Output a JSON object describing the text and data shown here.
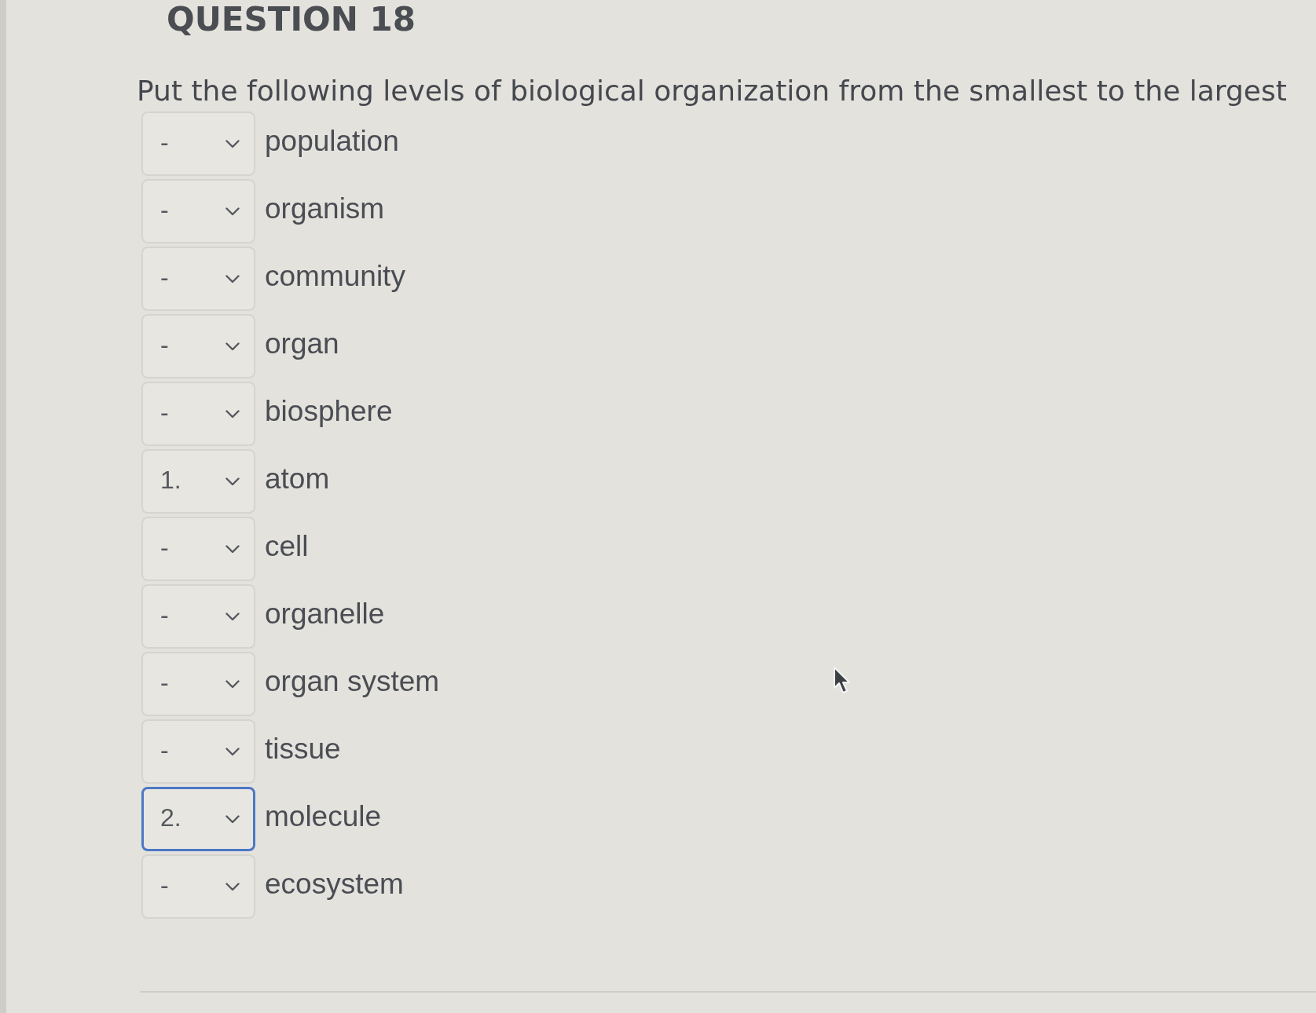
{
  "question": {
    "title": "QUESTION 18",
    "instruction": "Put the following levels of biological organization from the smallest to the largest"
  },
  "items": [
    {
      "value": "-",
      "label": "population",
      "focused": false
    },
    {
      "value": "-",
      "label": "organism",
      "focused": false
    },
    {
      "value": "-",
      "label": "community",
      "focused": false
    },
    {
      "value": "-",
      "label": "organ",
      "focused": false
    },
    {
      "value": "-",
      "label": "biosphere",
      "focused": false
    },
    {
      "value": "1.",
      "label": "atom",
      "focused": false
    },
    {
      "value": "-",
      "label": "cell",
      "focused": false
    },
    {
      "value": "-",
      "label": "organelle",
      "focused": false
    },
    {
      "value": "-",
      "label": "organ system",
      "focused": false
    },
    {
      "value": "-",
      "label": "tissue",
      "focused": false
    },
    {
      "value": "2.",
      "label": "molecule",
      "focused": true
    },
    {
      "value": "-",
      "label": "ecosystem",
      "focused": false
    }
  ]
}
